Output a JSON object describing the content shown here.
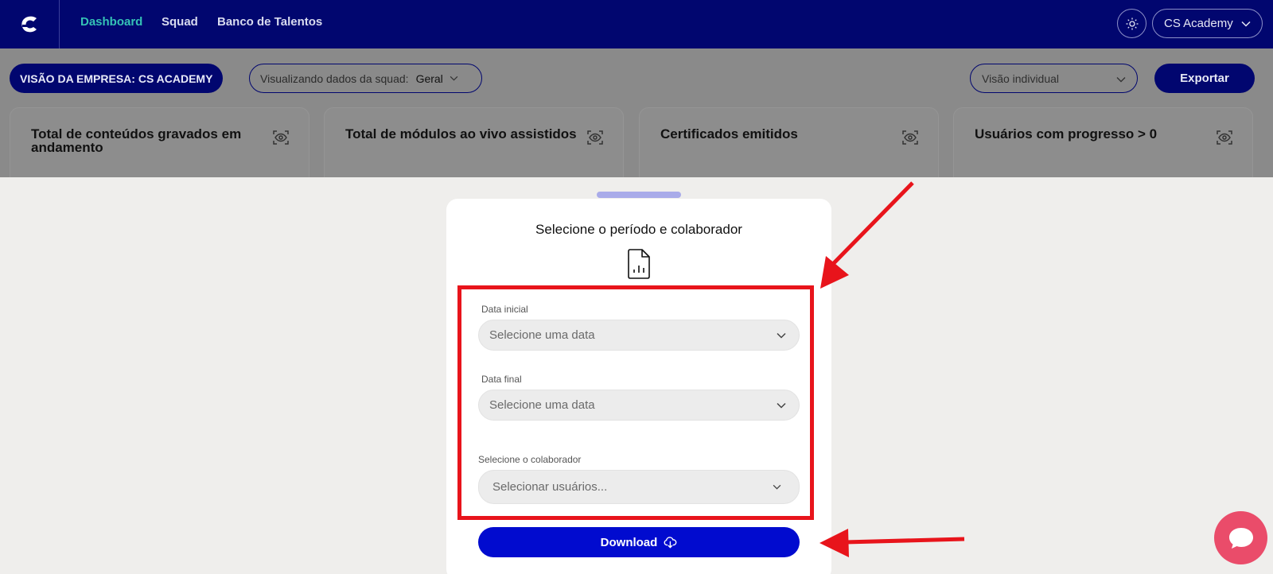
{
  "nav": {
    "logo_icon": "cs-logo-icon",
    "links": [
      "Dashboard",
      "Squad",
      "Banco de Talentos"
    ],
    "active": "Dashboard",
    "theme_icon": "sun-icon",
    "account_label": "CS Academy"
  },
  "toolbar": {
    "company_label": "VISÃO DA EMPRESA: CS ACADEMY",
    "squad_prefix": "Visualizando dados da squad:",
    "squad_value": "Geral",
    "view_select": "Visão individual",
    "export_label": "Exportar"
  },
  "cards": [
    {
      "title": "Total de conteúdos gravados em andamento",
      "icon": "eye-scan-icon"
    },
    {
      "title": "Total de módulos ao vivo assistidos",
      "icon": "eye-scan-icon"
    },
    {
      "title": "Certificados emitidos",
      "icon": "eye-scan-icon"
    },
    {
      "title": "Usuários com progresso > 0",
      "icon": "eye-scan-icon"
    }
  ],
  "modal": {
    "title": "Selecione o período e colaborador",
    "icon": "file-chart-icon",
    "start_date_label": "Data inicial",
    "start_date_placeholder": "Selecione uma data",
    "end_date_label": "Data final",
    "end_date_placeholder": "Selecione uma data",
    "collaborator_label": "Selecione o colaborador",
    "collaborator_placeholder": "Selecionar usuários...",
    "download_label": "Download",
    "download_icon": "cloud-download-icon"
  },
  "colors": {
    "navbar": "#01066f",
    "active_link": "#35c2b5",
    "download_button": "#010bcf",
    "annotation_red": "#e8141b",
    "chat_button": "#ea4c6a"
  },
  "chat_icon": "chat-bubble-icon"
}
